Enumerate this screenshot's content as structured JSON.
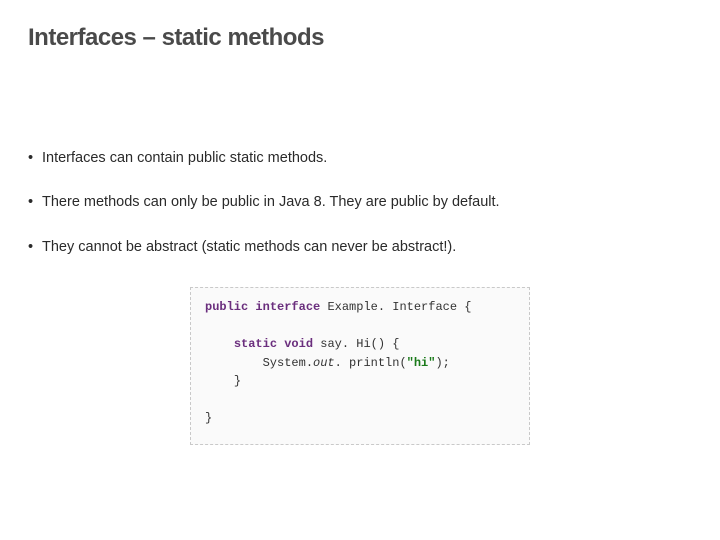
{
  "title": "Interfaces – static methods",
  "bullets": [
    "Interfaces can contain public static methods.",
    "There methods can only be public in Java 8. They are public by default.",
    "They cannot be abstract (static methods can never be abstract!)."
  ],
  "code": {
    "kw_public": "public",
    "kw_interface": "interface",
    "class_name": "Example. Interface",
    "brace_open": "{",
    "kw_static": "static",
    "kw_void": "void",
    "method_name": "say. Hi",
    "parens_open_brace": "() {",
    "sys": "System.",
    "out": "out",
    "dot_println": ". println(",
    "str_hi": "\"hi\"",
    "close_call": ");",
    "brace_close1": "}",
    "brace_close2": "}"
  }
}
